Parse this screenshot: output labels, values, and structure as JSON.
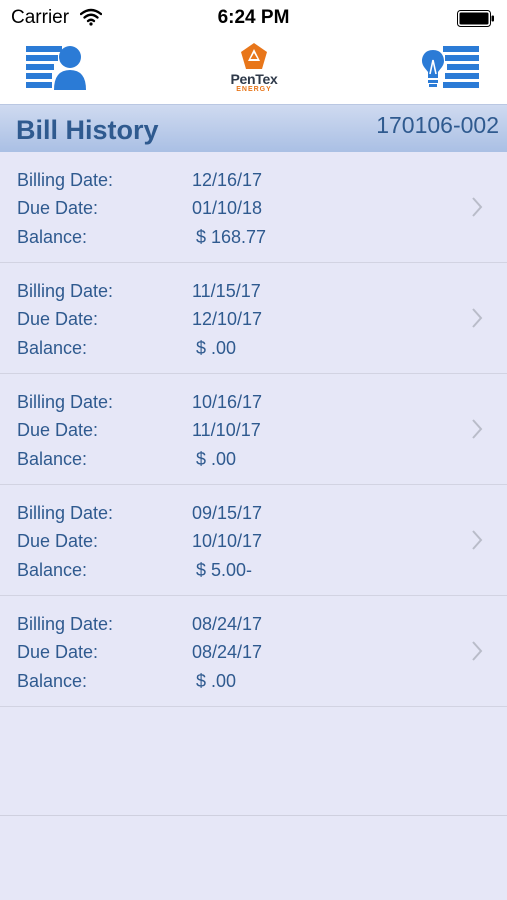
{
  "status_bar": {
    "carrier": "Carrier",
    "time": "6:24 PM",
    "wifi_icon": "wifi-icon",
    "battery_icon": "battery-icon"
  },
  "nav_bar": {
    "left_icon": "account-icon",
    "right_icon": "menu-icon",
    "logo": {
      "name": "PenTex",
      "sub": "ENERGY"
    }
  },
  "colors": {
    "text_blue": "#2f5a8f",
    "icon_blue": "#2b7bd6",
    "logo_orange": "#e8761a",
    "background": "#e6e7f7",
    "header_gradient_top": "#cfdaf0",
    "header_gradient_bottom": "#a9bfe4"
  },
  "header": {
    "title": "Bill History",
    "account_number": "170106-002"
  },
  "bills": [
    {
      "billing_date_label": "Billing Date:",
      "billing_date": "12/16/17",
      "due_date_label": "Due Date:",
      "due_date": "01/10/18",
      "balance_label": "Balance:",
      "balance": "$ 168.77"
    },
    {
      "billing_date_label": "Billing Date:",
      "billing_date": "11/15/17",
      "due_date_label": "Due Date:",
      "due_date": "12/10/17",
      "balance_label": "Balance:",
      "balance": "$ .00"
    },
    {
      "billing_date_label": "Billing Date:",
      "billing_date": "10/16/17",
      "due_date_label": "Due Date:",
      "due_date": "11/10/17",
      "balance_label": "Balance:",
      "balance": "$ .00"
    },
    {
      "billing_date_label": "Billing Date:",
      "billing_date": "09/15/17",
      "due_date_label": "Due Date:",
      "due_date": "10/10/17",
      "balance_label": "Balance:",
      "balance": "$ 5.00-"
    },
    {
      "billing_date_label": "Billing Date:",
      "billing_date": "08/24/17",
      "due_date_label": "Due Date:",
      "due_date": "08/24/17",
      "balance_label": "Balance:",
      "balance": "$ .00"
    }
  ]
}
